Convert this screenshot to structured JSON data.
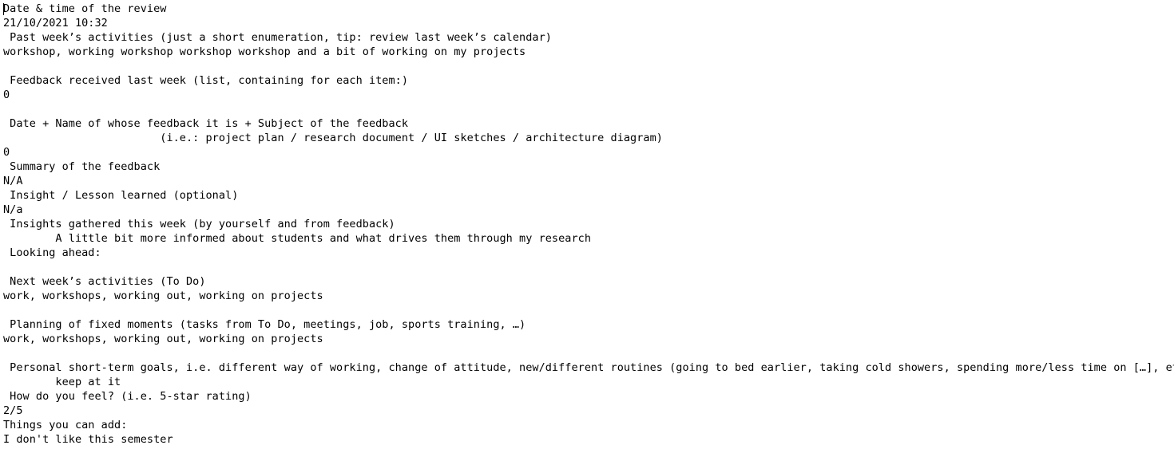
{
  "document": {
    "lines": [
      "Date & time of the review",
      "21/10/2021 10:32",
      " Past week’s activities (just a short enumeration, tip: review last week’s calendar)",
      "workshop, working workshop workshop workshop and a bit of working on my projects",
      "",
      " Feedback received last week (list, containing for each item:)",
      "0",
      "",
      " Date + Name of whose feedback it is + Subject of the feedback",
      "                        (i.e.: project plan / research document / UI sketches / architecture diagram)",
      "0",
      " Summary of the feedback",
      "N/A",
      " Insight / Lesson learned (optional)",
      "N/a",
      " Insights gathered this week (by yourself and from feedback)",
      "        A little bit more informed about students and what drives them through my research",
      " Looking ahead:",
      "",
      " Next week’s activities (To Do)",
      "work, workshops, working out, working on projects",
      "",
      " Planning of fixed moments (tasks from To Do, meetings, job, sports training, …)",
      "work, workshops, working out, working on projects",
      "",
      " Personal short-term goals, i.e. different way of working, change of attitude, new/different routines (going to bed earlier, taking cold showers, spending more/less time on […], etc.)",
      "        keep at it",
      " How do you feel? (i.e. 5-star rating)",
      "2/5",
      "Things you can add:",
      "I don't like this semester"
    ]
  }
}
